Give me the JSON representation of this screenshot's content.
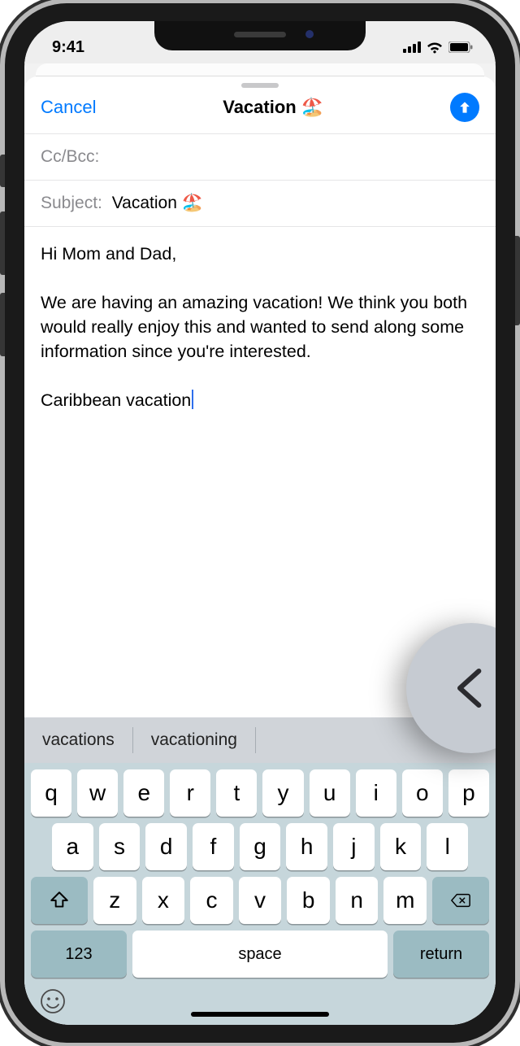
{
  "status": {
    "time": "9:41"
  },
  "nav": {
    "cancel": "Cancel",
    "title": "Vacation 🏖️"
  },
  "fields": {
    "ccbcc_label": "Cc/Bcc:",
    "subject_label": "Subject:",
    "subject_value": "Vacation 🏖️"
  },
  "body": {
    "line1": "Hi Mom and Dad,",
    "para": "We are having an amazing vacation! We think you both would really enjoy this and wanted to send along some information since you're interested.",
    "line2": "Caribbean vacation"
  },
  "predictive": {
    "s1": "vacations",
    "s2": "vacationing"
  },
  "keys": {
    "r1": [
      "q",
      "w",
      "e",
      "r",
      "t",
      "y",
      "u",
      "i",
      "o",
      "p"
    ],
    "r2": [
      "a",
      "s",
      "d",
      "f",
      "g",
      "h",
      "j",
      "k",
      "l"
    ],
    "r3": [
      "z",
      "x",
      "c",
      "v",
      "b",
      "n",
      "m"
    ],
    "num": "123",
    "space": "space",
    "return": "return"
  }
}
